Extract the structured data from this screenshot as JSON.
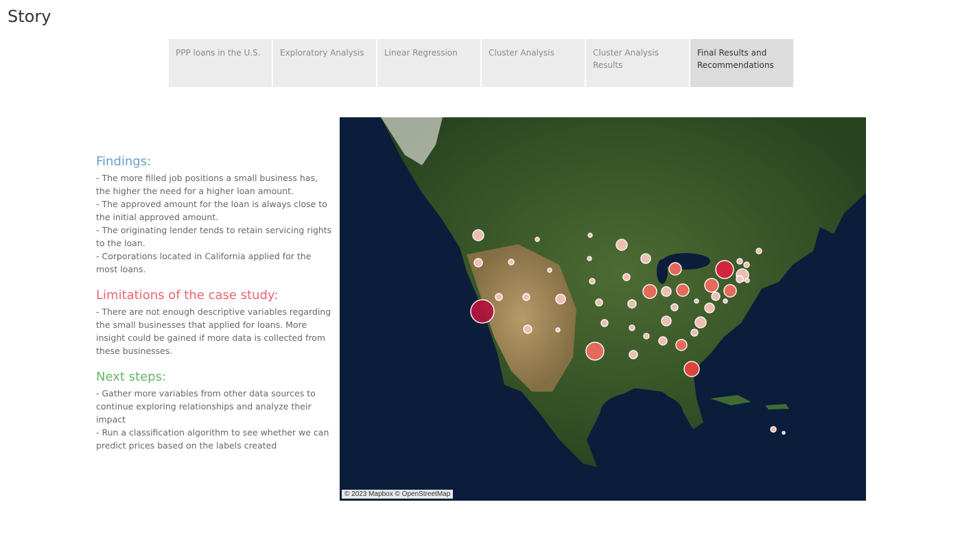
{
  "header": {
    "title": "Story"
  },
  "tabs": [
    {
      "label": "PPP loans in the U.S."
    },
    {
      "label": "Exploratory Analysis"
    },
    {
      "label": "Linear Regression"
    },
    {
      "label": "Cluster Analysis"
    },
    {
      "label": "Cluster Analysis Results"
    },
    {
      "label": "Final Results and Recommendations"
    }
  ],
  "findings": {
    "heading": "Findings:",
    "items": [
      "- The more filled job positions a small business has, the higher the need for a higher loan amount.",
      "- The approved amount for the loan is always close to the initial approved amount.",
      "- The originating lender tends to retain servicing rights to the loan.",
      "- Corporations located in California applied for the most loans."
    ]
  },
  "limitations": {
    "heading": "Limitations of the case study:",
    "items": [
      "- There are not enough descriptive variables regarding the small businesses that applied for loans. More insight could be gained if more data is collected from these businesses."
    ]
  },
  "next_steps": {
    "heading": "Next steps:",
    "items": [
      "- Gather more variables from other data sources to continue exploring relationships and analyze their impact",
      "- Run a classification algorithm to see whether we can predict prices based on the labels created"
    ]
  },
  "map": {
    "attribution": "© 2023 Mapbox © OpenStreetMap",
    "colors": {
      "ocean": "#0b1d3a",
      "land": "#355a2a",
      "desert": "#a88a5a",
      "low": "#f7c3b8",
      "mid": "#ee6b5c",
      "high": "#b3153f"
    }
  }
}
